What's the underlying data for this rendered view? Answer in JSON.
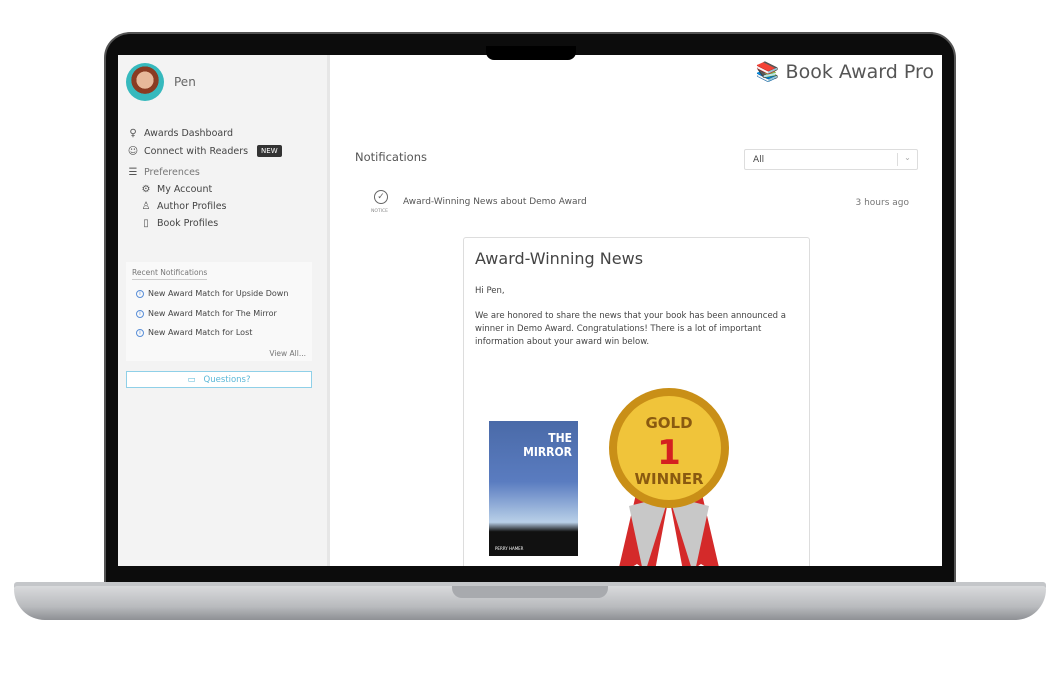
{
  "user": {
    "name": "Pen"
  },
  "sidebar": {
    "items": [
      {
        "label": "Awards Dashboard",
        "icon": "award-icon"
      },
      {
        "label": "Connect with Readers",
        "icon": "user-check-icon",
        "badge": "NEW"
      },
      {
        "label": "Preferences",
        "icon": "sliders-icon"
      },
      {
        "label": "My Account",
        "icon": "gear-icon"
      },
      {
        "label": "Author Profiles",
        "icon": "user-icon"
      },
      {
        "label": "Book Profiles",
        "icon": "book-icon"
      }
    ],
    "recent": {
      "title": "Recent Notifications",
      "items": [
        "New Award Match for Upside Down",
        "New Award Match for The Mirror",
        "New Award Match for Lost"
      ],
      "view_all": "View All..."
    },
    "questions": "Questions?"
  },
  "header": {
    "brand": "Book Award Pro"
  },
  "main": {
    "title": "Notifications",
    "filter": "All",
    "notification": {
      "type": "NOTICE",
      "title": "Award-Winning News about Demo Award",
      "time": "3 hours ago"
    },
    "card": {
      "title": "Award-Winning News",
      "greeting": "Hi Pen,",
      "body": "We are honored to share the news that your book has been announced a winner in Demo Award. Congratulations! There is a lot of important information about your award win below.",
      "book": {
        "title": "THE MIRROR",
        "author": "PERRY HAMER"
      },
      "medal": {
        "top": "GOLD",
        "number": "1",
        "bottom": "WINNER"
      }
    }
  },
  "colors": {
    "accent": "#5bb8d8",
    "medal": "#d9a520",
    "ribbon": "#d42a2a"
  }
}
